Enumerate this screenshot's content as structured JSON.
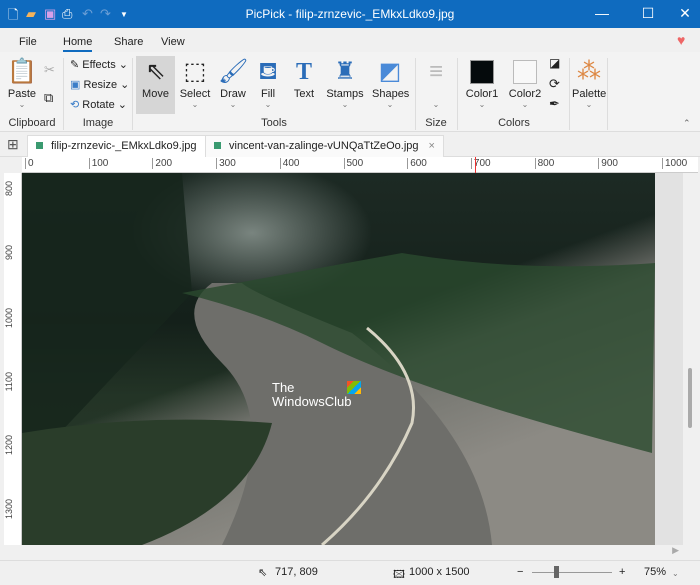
{
  "title": "PicPick - filip-zrnzevic-_EMkxLdko9.jpg",
  "menu": {
    "file": "File",
    "home": "Home",
    "share": "Share",
    "view": "View"
  },
  "ribbon": {
    "paste": "Paste",
    "effects": "Effects",
    "resize": "Resize",
    "rotate": "Rotate",
    "move": "Move",
    "select": "Select",
    "draw": "Draw",
    "fill": "Fill",
    "text": "Text",
    "stamps": "Stamps",
    "shapes": "Shapes",
    "color1": "Color1",
    "color2": "Color2",
    "palette": "Palette",
    "groups": {
      "clipboard": "Clipboard",
      "image": "Image",
      "tools": "Tools",
      "size": "Size",
      "colors": "Colors"
    },
    "color1_value": "#050a0c",
    "color2_value": "#f8f8f8"
  },
  "tabs": [
    {
      "label": "filip-zrnzevic-_EMkxLdko9.jpg"
    },
    {
      "label": "vincent-van-zalinge-vUNQaTtZeOo.jpg"
    }
  ],
  "ruler_h": [
    "0",
    "100",
    "200",
    "300",
    "400",
    "500",
    "600",
    "700",
    "800",
    "900",
    "1000"
  ],
  "ruler_v": [
    "800",
    "900",
    "1000",
    "1100",
    "1200",
    "1300"
  ],
  "watermark": {
    "line1": "The",
    "line2": "WindowsClub"
  },
  "status": {
    "cursor": "717, 809",
    "size": "1000 x 1500",
    "zoom": "75%",
    "zoom_minus": "−",
    "zoom_plus": "+"
  },
  "zoom_fraction": 0.3
}
